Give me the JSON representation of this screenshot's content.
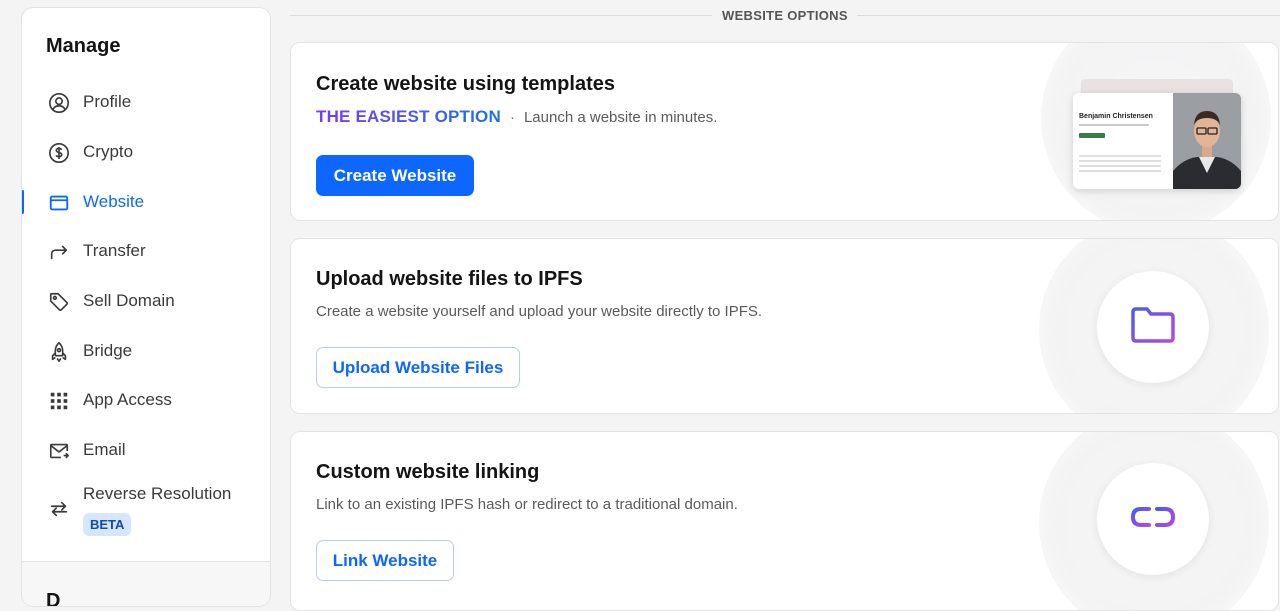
{
  "sidebar": {
    "title": "Manage",
    "items": [
      {
        "label": "Profile",
        "icon": "user-circle-icon"
      },
      {
        "label": "Crypto",
        "icon": "dollar-circle-icon"
      },
      {
        "label": "Website",
        "icon": "browser-window-icon",
        "active": true
      },
      {
        "label": "Transfer",
        "icon": "arrow-forward-icon"
      },
      {
        "label": "Sell Domain",
        "icon": "price-tag-icon"
      },
      {
        "label": "Bridge",
        "icon": "rocket-icon"
      },
      {
        "label": "App Access",
        "icon": "grid-dots-icon"
      },
      {
        "label": "Email",
        "icon": "envelope-icon"
      },
      {
        "label": "Reverse Resolution",
        "icon": "swap-arrows-icon"
      }
    ],
    "beta_badge": "BETA",
    "footer_label": "D"
  },
  "section": {
    "title": "WEBSITE OPTIONS"
  },
  "cards": {
    "templates": {
      "title": "Create website using templates",
      "badge": "THE EASIEST OPTION",
      "separator": "·",
      "desc": "Launch a website in minutes.",
      "button": "Create Website",
      "preview_name": "Benjamin Christensen"
    },
    "ipfs": {
      "title": "Upload website files to IPFS",
      "desc": "Create a website yourself and upload your website directly to IPFS.",
      "button": "Upload Website Files",
      "icon": "folder-icon"
    },
    "linking": {
      "title": "Custom website linking",
      "desc": "Link to an existing IPFS hash or redirect to a traditional domain.",
      "button": "Link Website",
      "icon": "link-icon"
    }
  },
  "colors": {
    "accent": "#0d67fe",
    "gradient_start": "#7a3cf0",
    "gradient_end": "#1b73e8"
  }
}
